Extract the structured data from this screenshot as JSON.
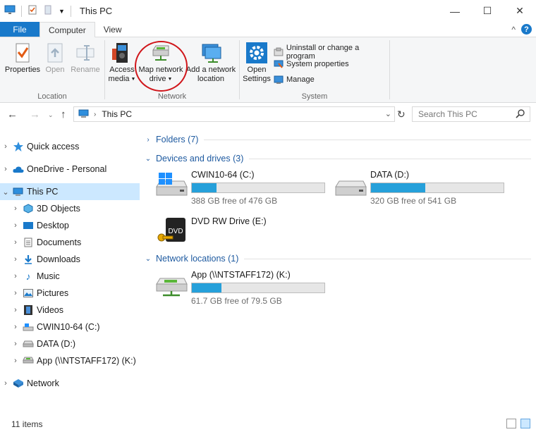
{
  "window": {
    "title": "This PC",
    "controls": {
      "minimize": "—",
      "maximize": "☐",
      "close": "✕"
    }
  },
  "tabs": {
    "file": "File",
    "computer": "Computer",
    "view": "View",
    "collapse": "^",
    "help": "?"
  },
  "ribbon": {
    "location": {
      "label": "Location",
      "properties": "Properties",
      "open": "Open",
      "rename": "Rename"
    },
    "network": {
      "label": "Network",
      "access_media_1": "Access",
      "access_media_2": "media",
      "map_drive_1": "Map network",
      "map_drive_2": "drive",
      "add_location_1": "Add a network",
      "add_location_2": "location"
    },
    "system": {
      "label": "System",
      "open_settings_1": "Open",
      "open_settings_2": "Settings",
      "uninstall": "Uninstall or change a program",
      "system_properties": "System properties",
      "manage": "Manage"
    }
  },
  "address": {
    "path": "This PC",
    "search_placeholder": "Search This PC"
  },
  "nav": {
    "quick_access": "Quick access",
    "onedrive": "OneDrive - Personal",
    "this_pc": "This PC",
    "objects3d": "3D Objects",
    "desktop": "Desktop",
    "documents": "Documents",
    "downloads": "Downloads",
    "music": "Music",
    "pictures": "Pictures",
    "videos": "Videos",
    "drive_c": "CWIN10-64 (C:)",
    "drive_d": "DATA (D:)",
    "drive_k": "App (\\\\NTSTAFF172) (K:)",
    "network": "Network"
  },
  "content": {
    "folders_header": "Folders (7)",
    "devices_header": "Devices and drives (3)",
    "network_header": "Network locations (1)",
    "drives": [
      {
        "name": "CWIN10-64 (C:)",
        "free": "388 GB free of 476 GB",
        "used_fraction": 0.185
      },
      {
        "name": "DATA (D:)",
        "free": "320 GB free of 541 GB",
        "used_fraction": 0.41
      },
      {
        "name": "DVD RW Drive (E:)"
      }
    ],
    "network_drives": [
      {
        "name": "App (\\\\NTSTAFF172) (K:)",
        "free": "61.7 GB free of 79.5 GB",
        "used_fraction": 0.224
      }
    ]
  },
  "status": {
    "items": "11 items"
  },
  "colors": {
    "accent": "#1979ca",
    "bar_fill": "#26a0da",
    "highlight_circle": "#d0161b",
    "selection": "#cce8ff"
  }
}
